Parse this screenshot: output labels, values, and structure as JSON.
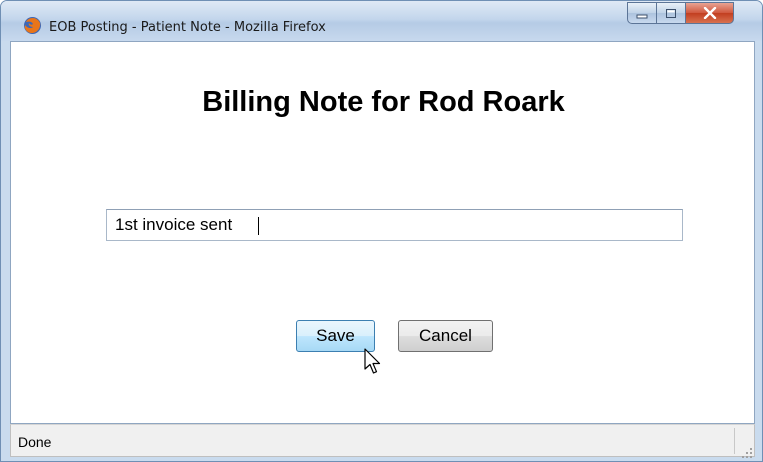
{
  "window": {
    "title": "EOB Posting - Patient Note - Mozilla Firefox",
    "icon": "firefox-icon",
    "controls": [
      "minimize-icon",
      "maximize-icon",
      "close-icon"
    ]
  },
  "page": {
    "heading": "Billing Note for Rod Roark",
    "note_value": "1st invoice sent"
  },
  "buttons": {
    "save_label": "Save",
    "cancel_label": "Cancel"
  },
  "status": {
    "text": "Done"
  },
  "colors": {
    "titlebar": "#c3d6ec",
    "close_button": "#c23e20",
    "save_button": "#bee6fd"
  }
}
